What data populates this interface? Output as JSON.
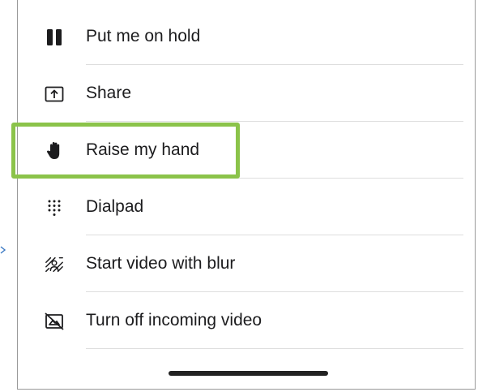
{
  "menu": {
    "items": [
      {
        "label": "Put me on hold",
        "icon": "pause-icon"
      },
      {
        "label": "Share",
        "icon": "share-upload-icon"
      },
      {
        "label": "Raise my hand",
        "icon": "raise-hand-icon"
      },
      {
        "label": "Dialpad",
        "icon": "dialpad-icon"
      },
      {
        "label": "Start video with blur",
        "icon": "video-blur-icon"
      },
      {
        "label": "Turn off incoming video",
        "icon": "video-off-icon"
      }
    ]
  },
  "highlight": {
    "target": "Raise my hand",
    "color": "#8bc34a"
  },
  "colors": {
    "text": "#1c1c1e",
    "divider": "#dedede",
    "icon": "#1c1c1e"
  }
}
